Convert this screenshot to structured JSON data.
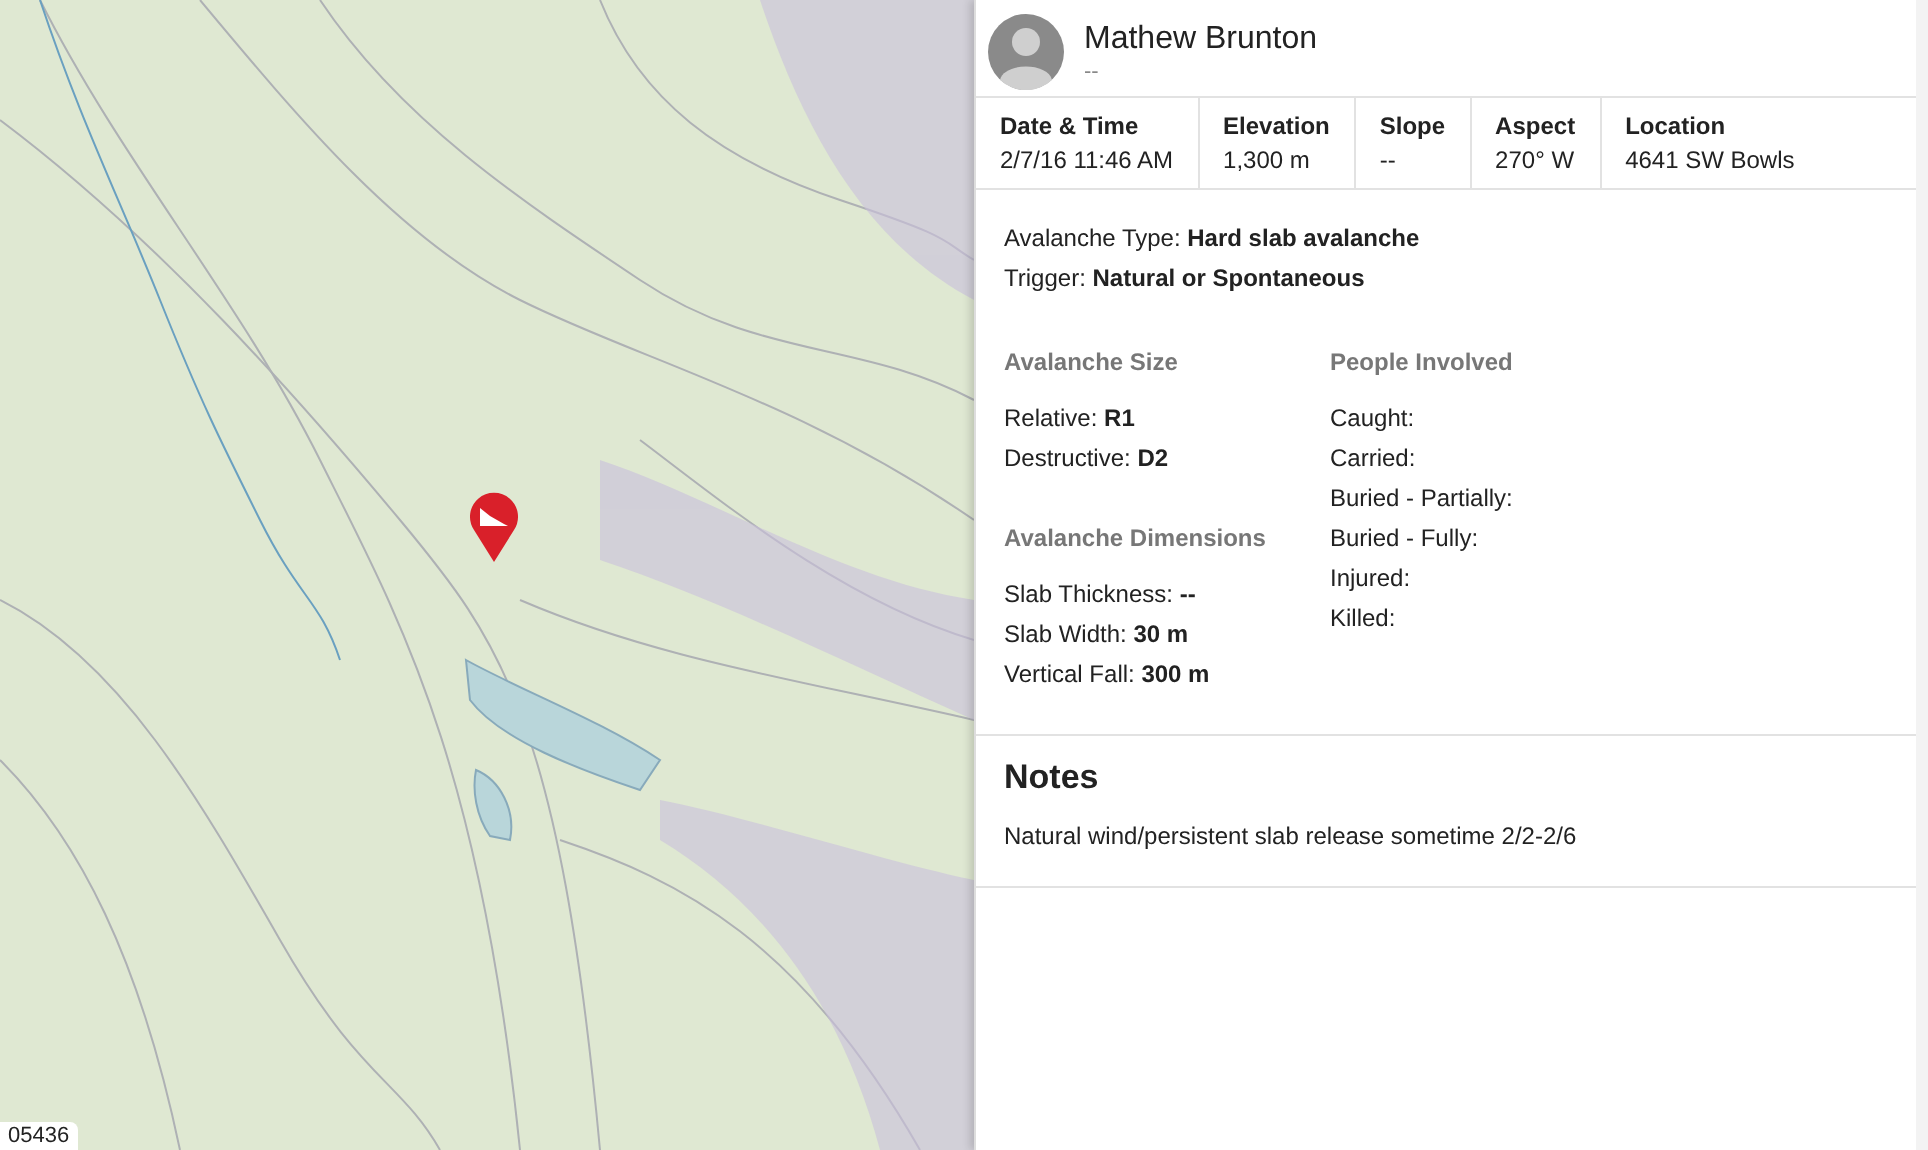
{
  "map": {
    "scale_label": "05436"
  },
  "observer": {
    "name": "Mathew Brunton",
    "subtitle": "--"
  },
  "stats": [
    {
      "label": "Date & Time",
      "value": "2/7/16 11:46 AM"
    },
    {
      "label": "Elevation",
      "value": "1,300 m"
    },
    {
      "label": "Slope",
      "value": "--"
    },
    {
      "label": "Aspect",
      "value": "270° W"
    },
    {
      "label": "Location",
      "value": "4641 SW Bowls"
    }
  ],
  "summary": [
    {
      "label": "Avalanche Type:",
      "value": "Hard slab avalanche"
    },
    {
      "label": "Trigger:",
      "value": "Natural or Spontaneous"
    }
  ],
  "columns": [
    [
      {
        "title": "Avalanche Size",
        "items": [
          {
            "label": "Relative:",
            "value": "R1"
          },
          {
            "label": "Destructive:",
            "value": "D2"
          }
        ]
      },
      {
        "title": "Avalanche Dimensions",
        "items": [
          {
            "label": "Slab Thickness:",
            "value": "--"
          },
          {
            "label": "Slab Width:",
            "value": "30 m"
          },
          {
            "label": "Vertical Fall:",
            "value": "300 m"
          }
        ]
      }
    ],
    [
      {
        "title": "People Involved",
        "items": [
          {
            "label": "Caught:"
          },
          {
            "label": "Carried:"
          },
          {
            "label": "Buried - Partially:"
          },
          {
            "label": "Buried - Fully:"
          },
          {
            "label": "Injured:"
          },
          {
            "label": "Killed:"
          }
        ]
      }
    ]
  ],
  "notes": {
    "title": "Notes",
    "text": "Natural wind/persistent slab release sometime 2/2-2/6"
  }
}
